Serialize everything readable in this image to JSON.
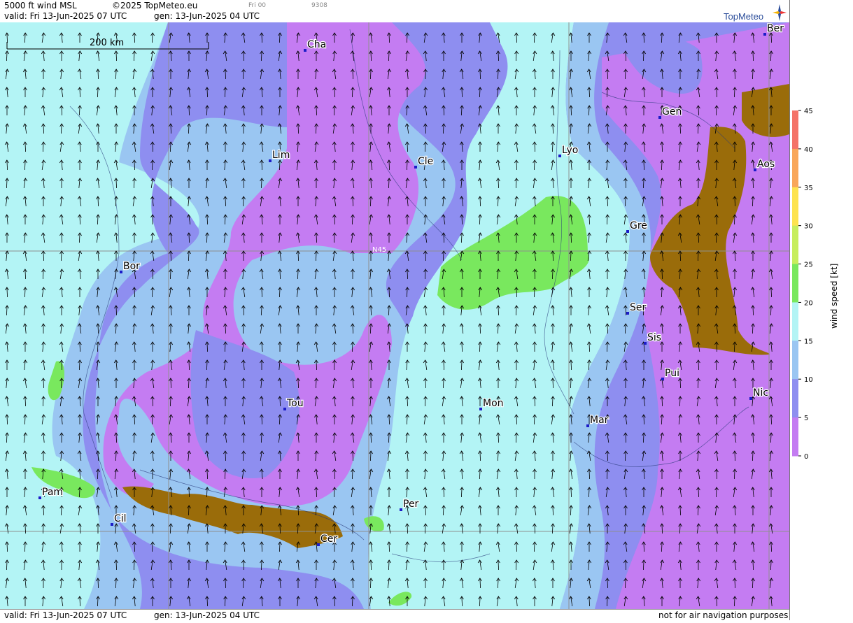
{
  "header": {
    "title": "5000 ft wind MSL",
    "copyright": "©2025 TopMeteo.eu",
    "run_label": "Fri 00",
    "code": "9308",
    "valid": "valid:  Fri  13-Jun-2025  07 UTC",
    "gen": "gen: 13-Jun-2025 04 UTC"
  },
  "logo": {
    "text": "TopMeteo",
    "icon": "compass-star-icon"
  },
  "scale_bar": {
    "label": "200 km"
  },
  "grid_label": "N45",
  "footer": {
    "valid": "valid:  Fri  13-Jun-2025  07 UTC",
    "gen": "gen: 13-Jun-2025 04 UTC",
    "disclaimer": "not for air navigation purposes"
  },
  "legend": {
    "label": "wind speed [kt]",
    "ticks": [
      "45",
      "40",
      "35",
      "30",
      "25",
      "20",
      "15",
      "10",
      "5",
      "0"
    ],
    "colors": [
      "#f47368",
      "#f9a75a",
      "#fde34f",
      "#c7ee5e",
      "#79e85e",
      "#b3f4f5",
      "#9ac6f2",
      "#8e8ef0",
      "#c47cf2"
    ]
  },
  "cities": [
    {
      "name": "Cha"
    },
    {
      "name": "Ber"
    },
    {
      "name": "Gen"
    },
    {
      "name": "Lim"
    },
    {
      "name": "Cle"
    },
    {
      "name": "Lyo"
    },
    {
      "name": "Aos"
    },
    {
      "name": "Gre"
    },
    {
      "name": "Bor"
    },
    {
      "name": "Ser"
    },
    {
      "name": "Sis"
    },
    {
      "name": "Pui"
    },
    {
      "name": "Tou"
    },
    {
      "name": "Mon"
    },
    {
      "name": "Nic"
    },
    {
      "name": "Mar"
    },
    {
      "name": "Pam"
    },
    {
      "name": "Per"
    },
    {
      "name": "Cil"
    },
    {
      "name": "Cer"
    }
  ],
  "colors": {
    "calm": "#c47cf2",
    "light": "#8e8ef0",
    "moderate": "#9ac6f2",
    "fresh": "#b3f4f5",
    "strong": "#79e85e",
    "terrain": "#9a6c0a"
  }
}
